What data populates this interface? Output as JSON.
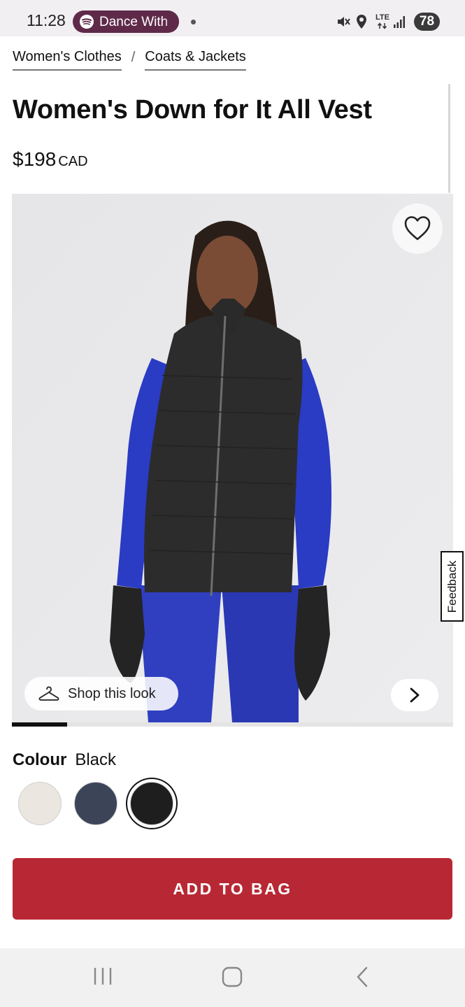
{
  "status_bar": {
    "time": "11:28",
    "media_title": "Dance With",
    "network": "LTE",
    "battery": "78"
  },
  "breadcrumb": [
    "Women's Clothes",
    "Coats & Jackets"
  ],
  "product": {
    "title": "Women's Down for It All Vest",
    "price": "$198",
    "currency": "CAD"
  },
  "image_gallery": {
    "shop_look_label": "Shop this look",
    "progress_fraction": 0.125,
    "feedback_label": "Feedback"
  },
  "colour": {
    "label": "Colour",
    "selected": "Black",
    "swatches": [
      "#ebe6df",
      "#3c4558",
      "#1e1e1e"
    ],
    "selected_index": 2
  },
  "cta": {
    "add_to_bag": "ADD TO BAG",
    "color": "#b82834"
  }
}
